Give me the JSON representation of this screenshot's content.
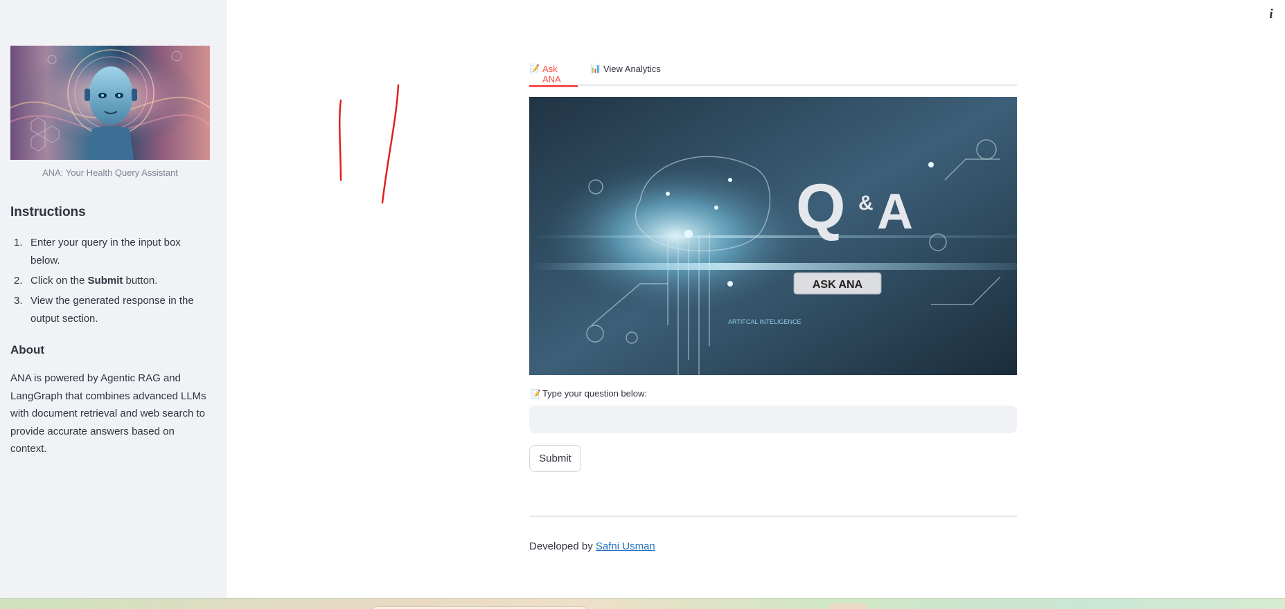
{
  "sidebar": {
    "hero_caption": "ANA: Your Health Query Assistant",
    "instructions_title": "Instructions",
    "steps": [
      {
        "num": "1.",
        "text": "Enter your query in the input box below."
      },
      {
        "num": "2.",
        "text_before": "Click on the ",
        "bold": "Submit",
        "text_after": " button."
      },
      {
        "num": "3.",
        "text": "View the generated response in the output section."
      }
    ],
    "about_title": "About",
    "about_text": "ANA is powered by Agentic RAG and LangGraph that combines advanced LLMs with document retrieval and web search to provide accurate answers based on context."
  },
  "header": {
    "info_icon": "i"
  },
  "tabs": [
    {
      "label": "Ask ANA",
      "icon": "memo-icon",
      "icon_char": "📝",
      "active": true
    },
    {
      "label": "View Analytics",
      "icon": "bar-chart-icon",
      "icon_char": "📊",
      "active": false
    }
  ],
  "banner": {
    "q": "Q",
    "amp": "&",
    "a": "A",
    "button_text": "ASK ANA",
    "tagline": "ARTIFCAL INTELIGENCE"
  },
  "question": {
    "icon_char": "📝",
    "label": "Type your question below:",
    "value": "",
    "placeholder": ""
  },
  "submit_label": "Submit",
  "footer": {
    "prefix": "Developed by ",
    "link_text": "Safni Usman"
  },
  "colors": {
    "accent": "#ff4b4b",
    "sidebar_bg": "#f0f2f6",
    "text": "#31333f",
    "link": "#1f6fc0"
  }
}
